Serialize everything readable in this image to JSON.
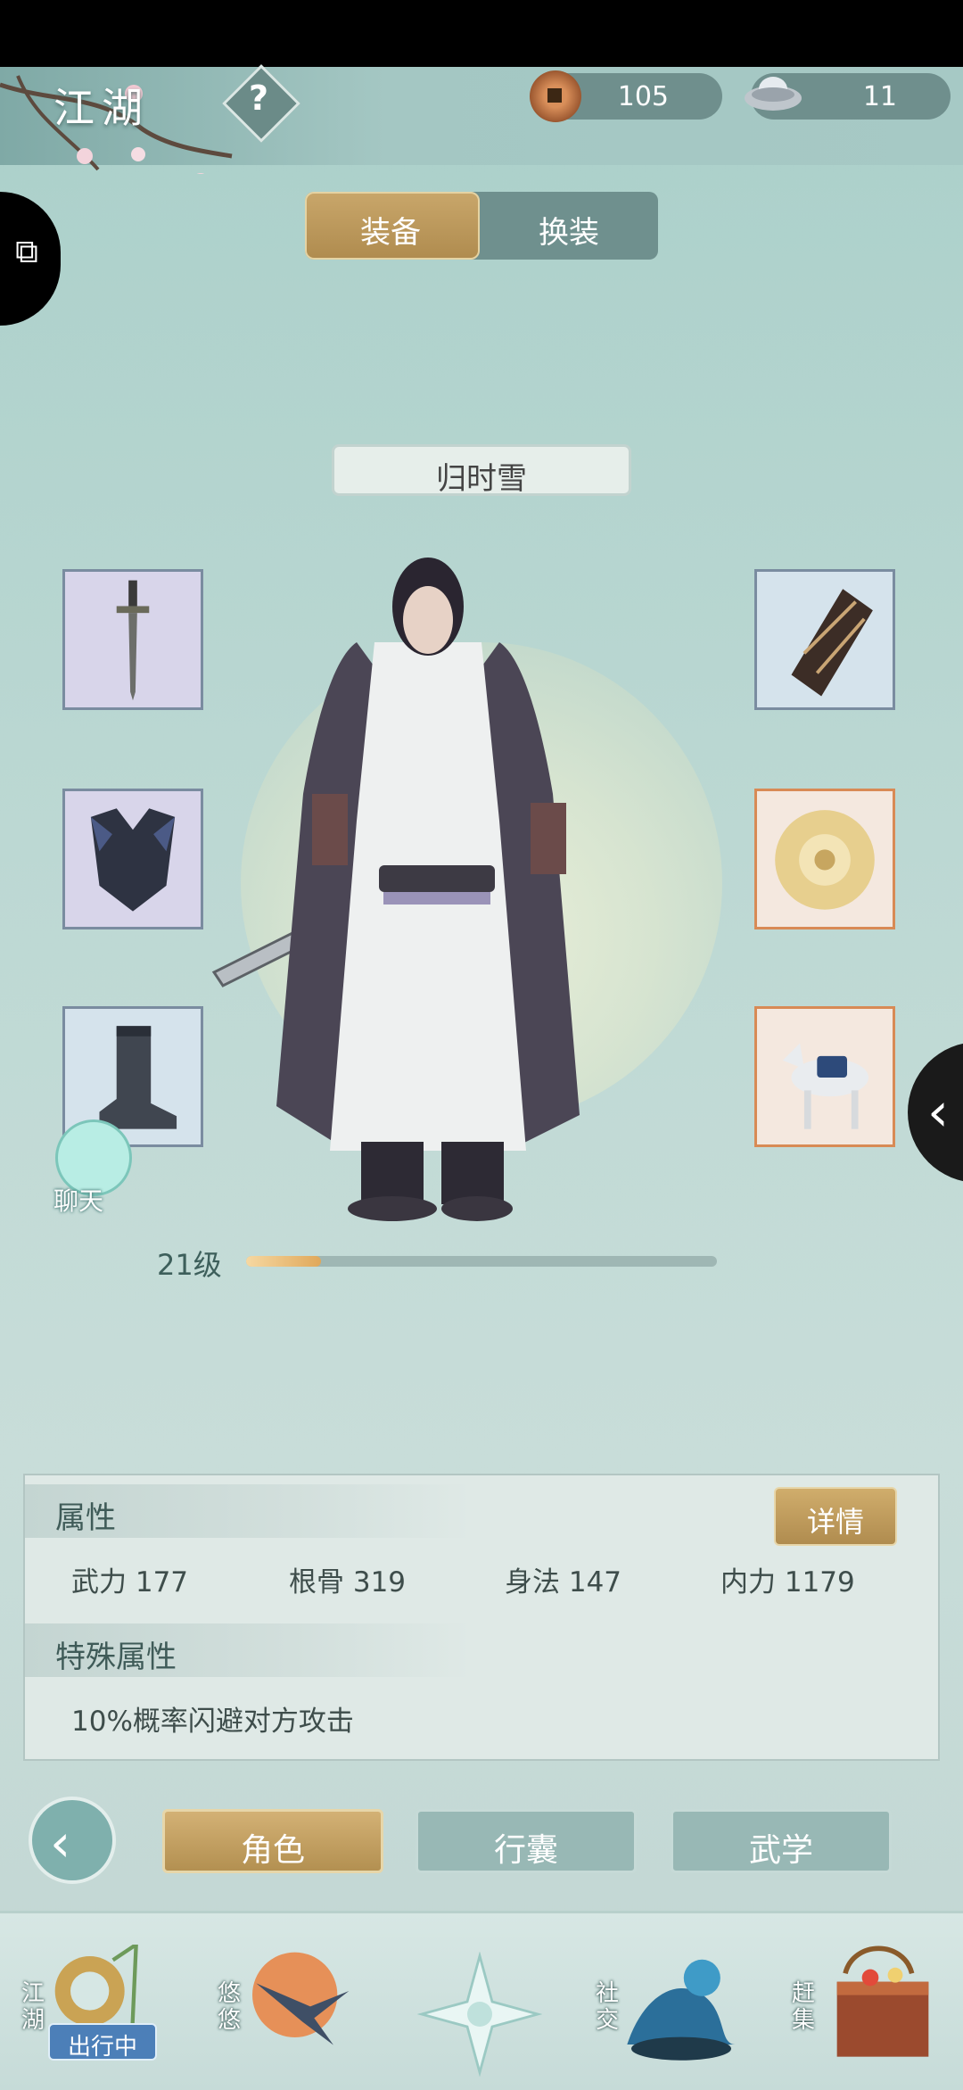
{
  "header": {
    "title": "江湖",
    "copper": "105",
    "silver": "11"
  },
  "tabs_top": {
    "equip": "装备",
    "outfit": "换装"
  },
  "character": {
    "name": "归时雪",
    "level": "21级",
    "xp_progress": 0.16
  },
  "slots": {
    "left": [
      "weapon",
      "armor",
      "boots"
    ],
    "right": [
      "bracer",
      "jade-pendant",
      "horse"
    ]
  },
  "chat": {
    "label": "聊天"
  },
  "attributes": {
    "header": "属性",
    "detail_button": "详情",
    "stats": [
      {
        "label": "武力",
        "value": "177"
      },
      {
        "label": "根骨",
        "value": "319"
      },
      {
        "label": "身法",
        "value": "147"
      },
      {
        "label": "内力",
        "value": "1179"
      }
    ],
    "special_header": "特殊属性",
    "special_text": "10%概率闪避对方攻击"
  },
  "bottom_tabs": [
    "角色",
    "行囊",
    "武学"
  ],
  "nav": {
    "jianghu": "江湖",
    "jianghu_badge": "出行中",
    "youyou": "悠悠",
    "shejiao": "社交",
    "ganji": "赶集"
  },
  "colors": {
    "gold": "#c8a66a",
    "teal_bg": "#bcd8d3",
    "slot_orange_border": "#d88a55"
  }
}
